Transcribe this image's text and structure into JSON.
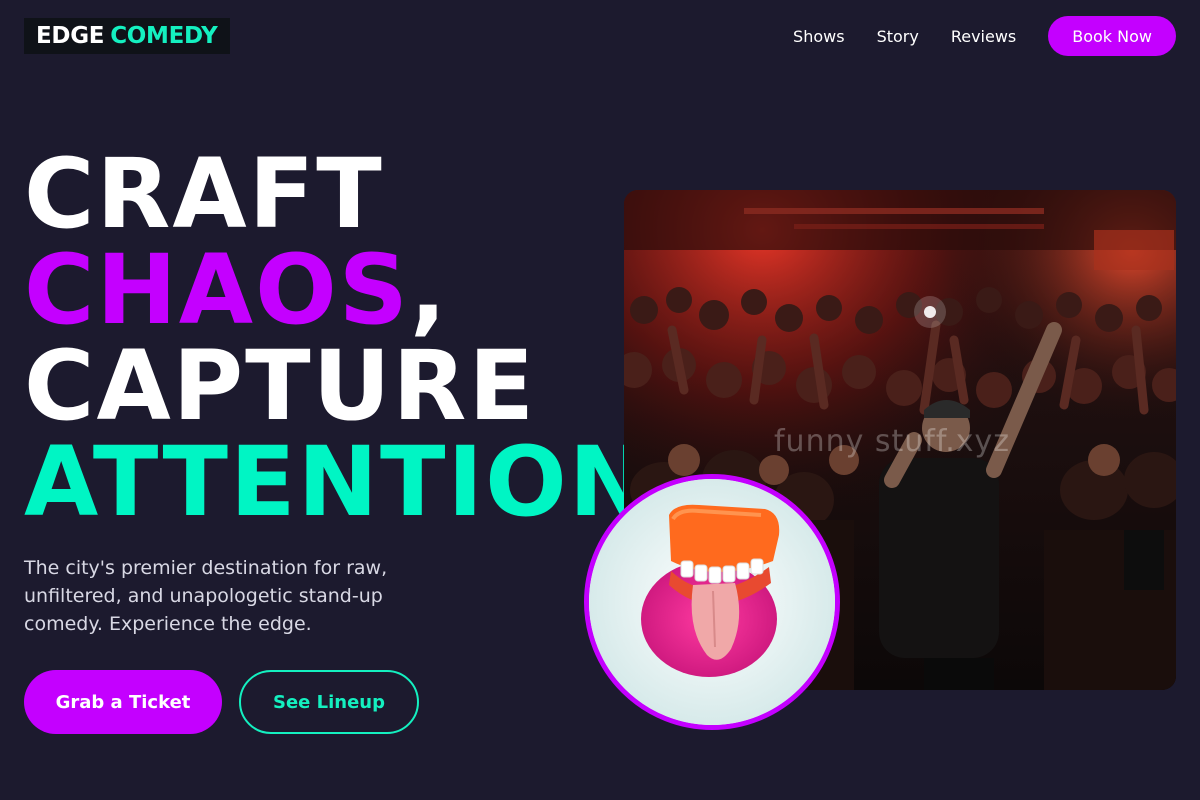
{
  "brand": {
    "word1": "EDGE",
    "word2": "COMEDY"
  },
  "nav": {
    "links": [
      "Shows",
      "Story",
      "Reviews"
    ],
    "cta": "Book Now"
  },
  "hero": {
    "line1": "CRAFT",
    "line2_word": "CHAOS",
    "line2_punct": ",",
    "line3": "CAPTURE",
    "line4": "ATTENTION",
    "tagline": "The city's premier destination for raw, unfiltered, and unapologetic stand-up comedy. Experience the edge.",
    "primary_cta": "Grab a Ticket",
    "secondary_cta": "See Lineup"
  },
  "media": {
    "photo_watermark": "funny stuff.xyz",
    "photo_subject": "crowd-at-comedy-show",
    "circle_subject": "novelty-wind-up-teeth-candy"
  },
  "colors": {
    "background": "#1c1a2e",
    "accent_pink": "#c400ff",
    "accent_teal": "#00f5c4",
    "text_white": "#ffffff"
  }
}
